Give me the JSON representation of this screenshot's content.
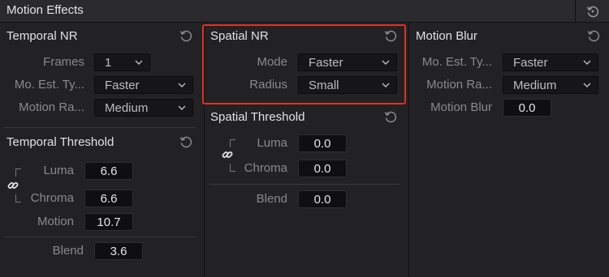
{
  "window": {
    "title": "Motion Effects",
    "reset_all_icon": "reset-arrow-icon"
  },
  "temporal_nr": {
    "title": "Temporal NR",
    "frames": {
      "label": "Frames",
      "value": "1"
    },
    "mo_est_type": {
      "label": "Mo. Est. Ty...",
      "value": "Faster"
    },
    "motion_range": {
      "label": "Motion Ra...",
      "value": "Medium"
    }
  },
  "temporal_threshold": {
    "title": "Temporal Threshold",
    "luma": {
      "label": "Luma",
      "value": "6.6"
    },
    "chroma": {
      "label": "Chroma",
      "value": "6.6"
    },
    "motion": {
      "label": "Motion",
      "value": "10.7"
    },
    "blend": {
      "label": "Blend",
      "value": "3.6"
    }
  },
  "spatial_nr": {
    "title": "Spatial NR",
    "mode": {
      "label": "Mode",
      "value": "Faster"
    },
    "radius": {
      "label": "Radius",
      "value": "Small"
    }
  },
  "spatial_threshold": {
    "title": "Spatial Threshold",
    "luma": {
      "label": "Luma",
      "value": "0.0"
    },
    "chroma": {
      "label": "Chroma",
      "value": "0.0"
    },
    "blend": {
      "label": "Blend",
      "value": "0.0"
    }
  },
  "motion_blur": {
    "title": "Motion Blur",
    "mo_est_type": {
      "label": "Mo. Est. Ty...",
      "value": "Faster"
    },
    "motion_range": {
      "label": "Motion Ra...",
      "value": "Medium"
    },
    "motion_blur": {
      "label": "Motion Blur",
      "value": "0.0"
    }
  },
  "colors": {
    "highlight": "#e0302a",
    "background": "#222224"
  }
}
